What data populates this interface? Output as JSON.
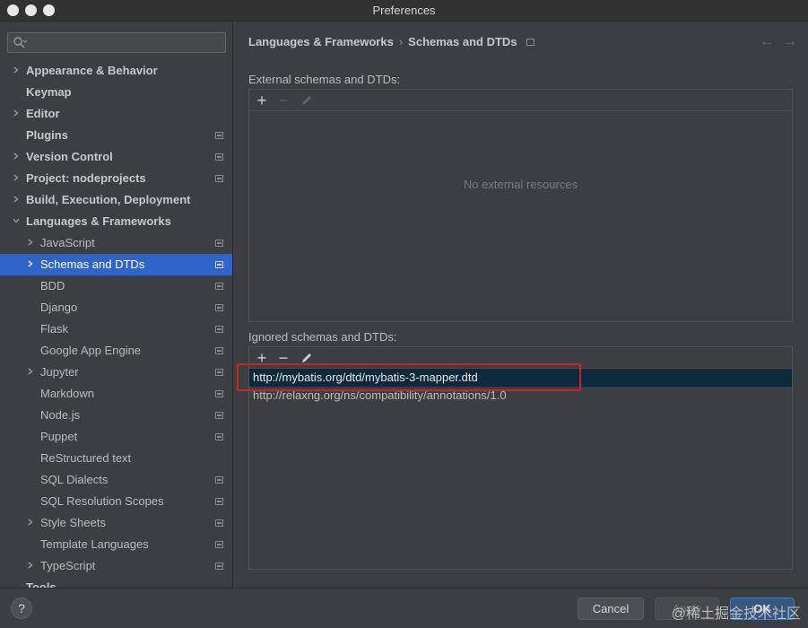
{
  "window": {
    "title": "Preferences"
  },
  "search": {
    "placeholder": ""
  },
  "sidebar": {
    "items": [
      {
        "label": "Appearance & Behavior",
        "level": 0,
        "expandable": true,
        "bold": true,
        "project": false
      },
      {
        "label": "Keymap",
        "level": 0,
        "expandable": false,
        "bold": true,
        "project": false
      },
      {
        "label": "Editor",
        "level": 0,
        "expandable": true,
        "bold": true,
        "project": false
      },
      {
        "label": "Plugins",
        "level": 0,
        "expandable": false,
        "bold": true,
        "project": true
      },
      {
        "label": "Version Control",
        "level": 0,
        "expandable": true,
        "bold": true,
        "project": true
      },
      {
        "label": "Project: nodeprojects",
        "level": 0,
        "expandable": true,
        "bold": true,
        "project": true
      },
      {
        "label": "Build, Execution, Deployment",
        "level": 0,
        "expandable": true,
        "bold": true,
        "project": false
      },
      {
        "label": "Languages & Frameworks",
        "level": 0,
        "expandable": true,
        "expanded": true,
        "bold": true,
        "project": false
      },
      {
        "label": "JavaScript",
        "level": 1,
        "expandable": true,
        "bold": false,
        "project": true
      },
      {
        "label": "Schemas and DTDs",
        "level": 1,
        "expandable": true,
        "bold": false,
        "project": true,
        "selected": true
      },
      {
        "label": "BDD",
        "level": 1,
        "expandable": false,
        "bold": false,
        "project": true
      },
      {
        "label": "Django",
        "level": 1,
        "expandable": false,
        "bold": false,
        "project": true
      },
      {
        "label": "Flask",
        "level": 1,
        "expandable": false,
        "bold": false,
        "project": true
      },
      {
        "label": "Google App Engine",
        "level": 1,
        "expandable": false,
        "bold": false,
        "project": true
      },
      {
        "label": "Jupyter",
        "level": 1,
        "expandable": true,
        "bold": false,
        "project": true
      },
      {
        "label": "Markdown",
        "level": 1,
        "expandable": false,
        "bold": false,
        "project": true
      },
      {
        "label": "Node.js",
        "level": 1,
        "expandable": false,
        "bold": false,
        "project": true
      },
      {
        "label": "Puppet",
        "level": 1,
        "expandable": false,
        "bold": false,
        "project": true
      },
      {
        "label": "ReStructured text",
        "level": 1,
        "expandable": false,
        "bold": false,
        "project": false
      },
      {
        "label": "SQL Dialects",
        "level": 1,
        "expandable": false,
        "bold": false,
        "project": true
      },
      {
        "label": "SQL Resolution Scopes",
        "level": 1,
        "expandable": false,
        "bold": false,
        "project": true
      },
      {
        "label": "Style Sheets",
        "level": 1,
        "expandable": true,
        "bold": false,
        "project": true
      },
      {
        "label": "Template Languages",
        "level": 1,
        "expandable": false,
        "bold": false,
        "project": true
      },
      {
        "label": "TypeScript",
        "level": 1,
        "expandable": true,
        "bold": false,
        "project": true
      }
    ],
    "cut_item": "Tools"
  },
  "breadcrumb": {
    "parent": "Languages & Frameworks",
    "current": "Schemas and DTDs"
  },
  "external": {
    "label": "External schemas and DTDs:",
    "empty_text": "No external resources"
  },
  "ignored": {
    "label": "Ignored schemas and DTDs:",
    "rows": [
      {
        "url": "http://mybatis.org/dtd/mybatis-3-mapper.dtd",
        "selected": true
      },
      {
        "url": "http://relaxng.org/ns/compatibility/annotations/1.0",
        "selected": false
      }
    ]
  },
  "footer": {
    "help_label": "?",
    "cancel_label": "Cancel",
    "apply_label": "Apply",
    "ok_label": "OK",
    "watermark": "@稀土掘金技术社区"
  },
  "colors": {
    "selection": "#2f65ca",
    "row_selection": "#0d293e",
    "highlight": "#d32020",
    "ok_button": "#365880"
  }
}
